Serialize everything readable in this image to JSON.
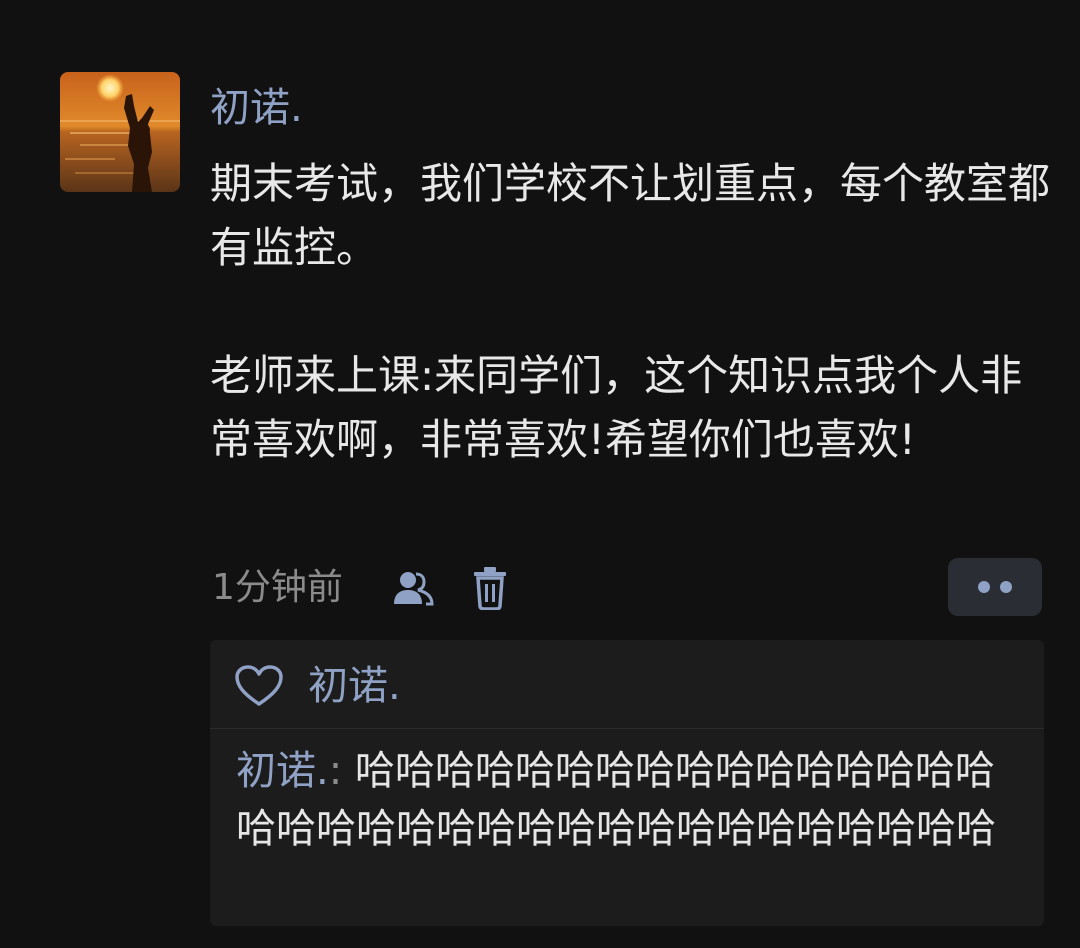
{
  "post": {
    "author": "初诺.",
    "content": "期末考试，我们学校不让划重点，每个教室都有监控。\n\n老师来上课:来同学们，这个知识点我个人非常喜欢啊，非常喜欢!希望你们也喜欢!",
    "time": "1分钟前",
    "icons": {
      "avatar": "sunset-silhouette-photo",
      "privacy": "people-icon",
      "delete": "trash-icon",
      "more": "more-dots-icon"
    }
  },
  "likes": {
    "icon": "heart-icon",
    "names": "初诺."
  },
  "comments": [
    {
      "author": "初诺.",
      "separator": ":",
      "text": " 哈哈哈哈哈哈哈哈哈哈哈哈哈哈哈哈哈哈哈哈哈哈哈哈哈哈哈哈哈哈哈哈哈哈哈"
    }
  ],
  "colors": {
    "background": "#111111",
    "link": "#8fa1c4",
    "text": "#e8e8e8",
    "muted": "#8b8b8b",
    "panel": "#1c1c1c"
  }
}
